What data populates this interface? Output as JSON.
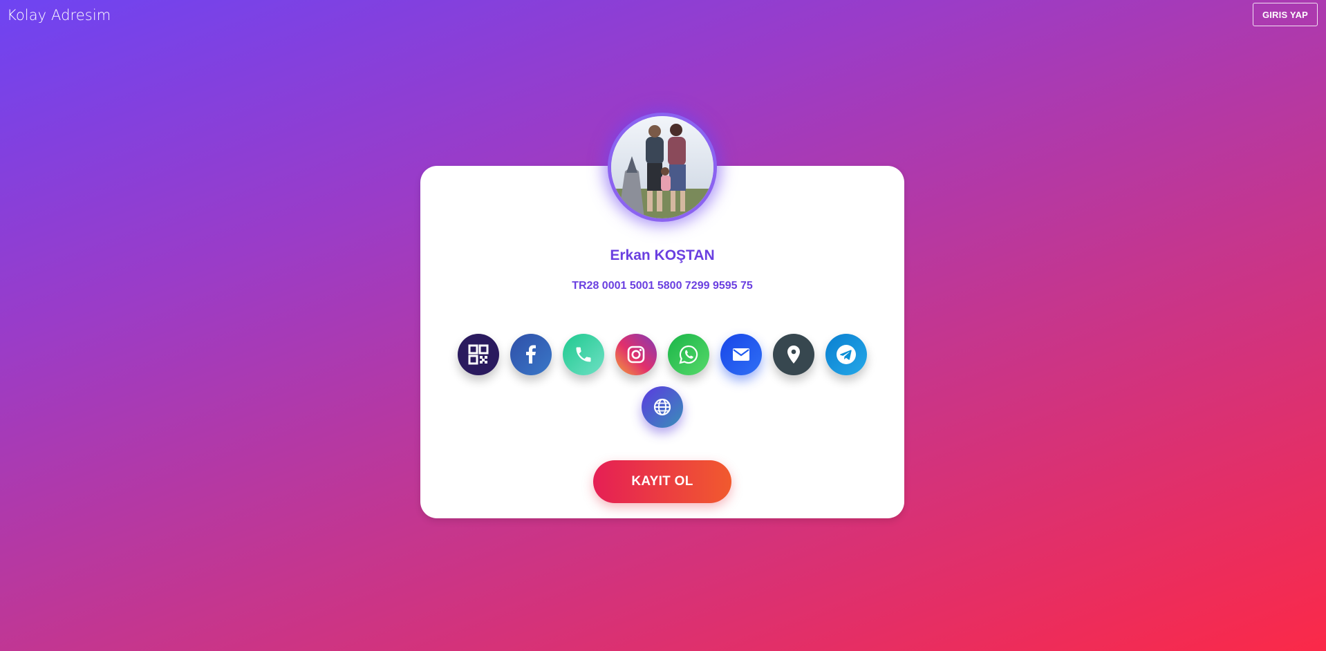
{
  "app": {
    "brand": "Kolay Adresim",
    "login_label": "GIRIS YAP"
  },
  "profile": {
    "name": "Erkan KOŞTAN",
    "iban": "TR28 0001 5001 5800 7299 9595 75",
    "avatar_icon": "family-photo"
  },
  "contacts": [
    {
      "name": "qr-code",
      "icon": "qr-code-icon",
      "color": "#2a1a5e"
    },
    {
      "name": "facebook",
      "icon": "facebook-icon",
      "color": "#2f5fb0"
    },
    {
      "name": "phone",
      "icon": "phone-icon",
      "color": "#2fd0a0"
    },
    {
      "name": "instagram",
      "icon": "instagram-icon",
      "color": "#c13584"
    },
    {
      "name": "whatsapp",
      "icon": "whatsapp-icon",
      "color": "#2bc44a"
    },
    {
      "name": "email",
      "icon": "mail-icon",
      "color": "#1e5af0"
    },
    {
      "name": "location",
      "icon": "map-pin-icon",
      "color": "#37474f"
    },
    {
      "name": "telegram",
      "icon": "telegram-icon",
      "color": "#0a8fd6"
    },
    {
      "name": "website",
      "icon": "globe-icon",
      "color": "#5a4fd0"
    }
  ],
  "actions": {
    "register_label": "KAYIT OL"
  }
}
